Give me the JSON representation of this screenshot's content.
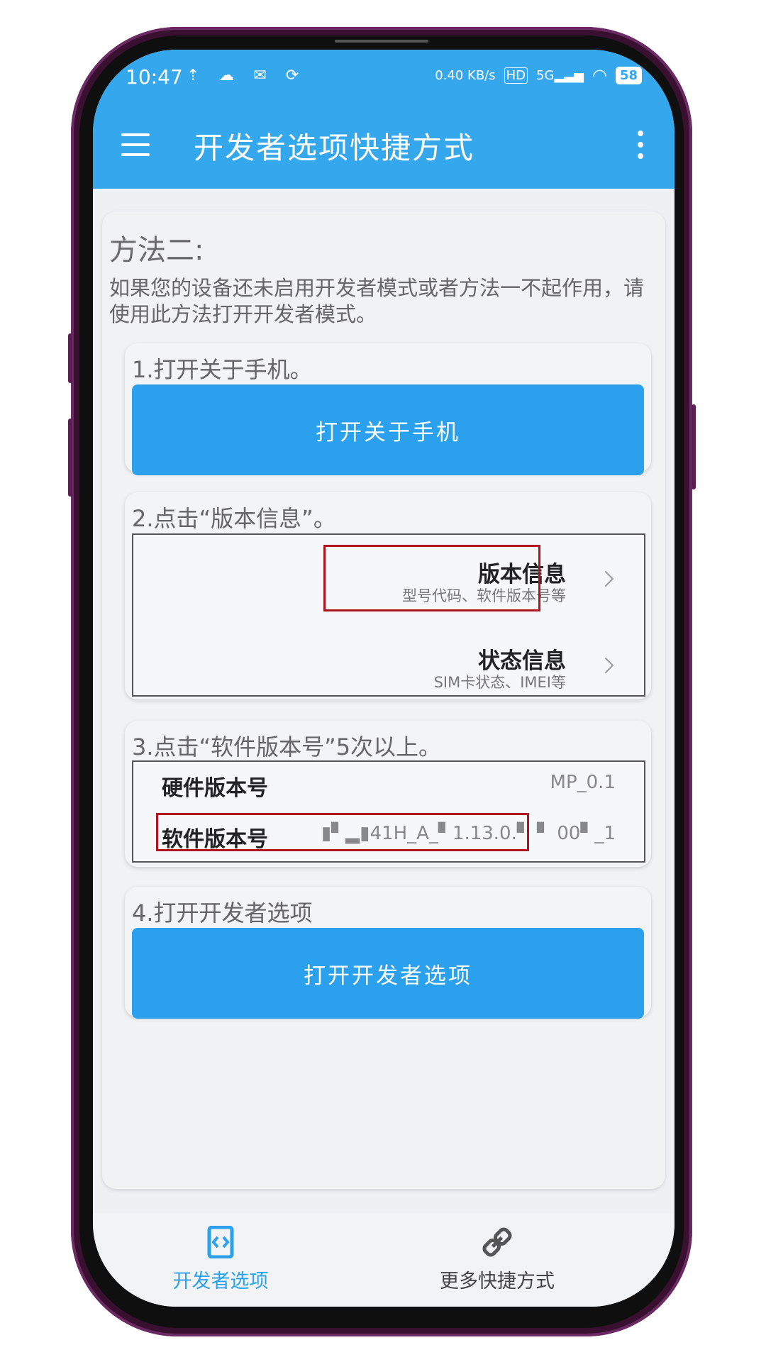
{
  "status_bar": {
    "time": "10:47",
    "speed": "0.40 KB/s",
    "hd": "HD",
    "network": "5G",
    "battery": "58"
  },
  "app_bar": {
    "title": "开发者选项快捷方式"
  },
  "method": {
    "title": "方法二:",
    "description": "如果您的设备还未启用开发者模式或者方法一不起作用，请使用此方法打开开发者模式。"
  },
  "steps": [
    {
      "title": "1.打开关于手机。",
      "button_label": "打开关于手机"
    },
    {
      "title": "2.点击“版本信息”。",
      "items": [
        {
          "title": "版本信息",
          "subtitle": "型号代码、软件版本号等"
        },
        {
          "title": "状态信息",
          "subtitle": "SIM卡状态、IMEI等"
        }
      ]
    },
    {
      "title": "3.点击“软件版本号”5次以上。",
      "rows": [
        {
          "label": "硬件版本号",
          "value": "MP_0.1"
        },
        {
          "label": "软件版本号",
          "value": "▮▘▂▮41H_A_▘1.13.0.▘ ▘ 00▘_1"
        }
      ]
    },
    {
      "title": "4.打开开发者选项",
      "button_label": "打开开发者选项"
    }
  ],
  "bottom_nav": {
    "items": [
      {
        "label": "开发者选项",
        "active": true
      },
      {
        "label": "更多快捷方式",
        "active": false
      }
    ]
  },
  "colors": {
    "accent": "#35a7ec",
    "button": "#2ba1ee",
    "highlight": "#b0141e",
    "active_nav": "#2ba1ee"
  }
}
